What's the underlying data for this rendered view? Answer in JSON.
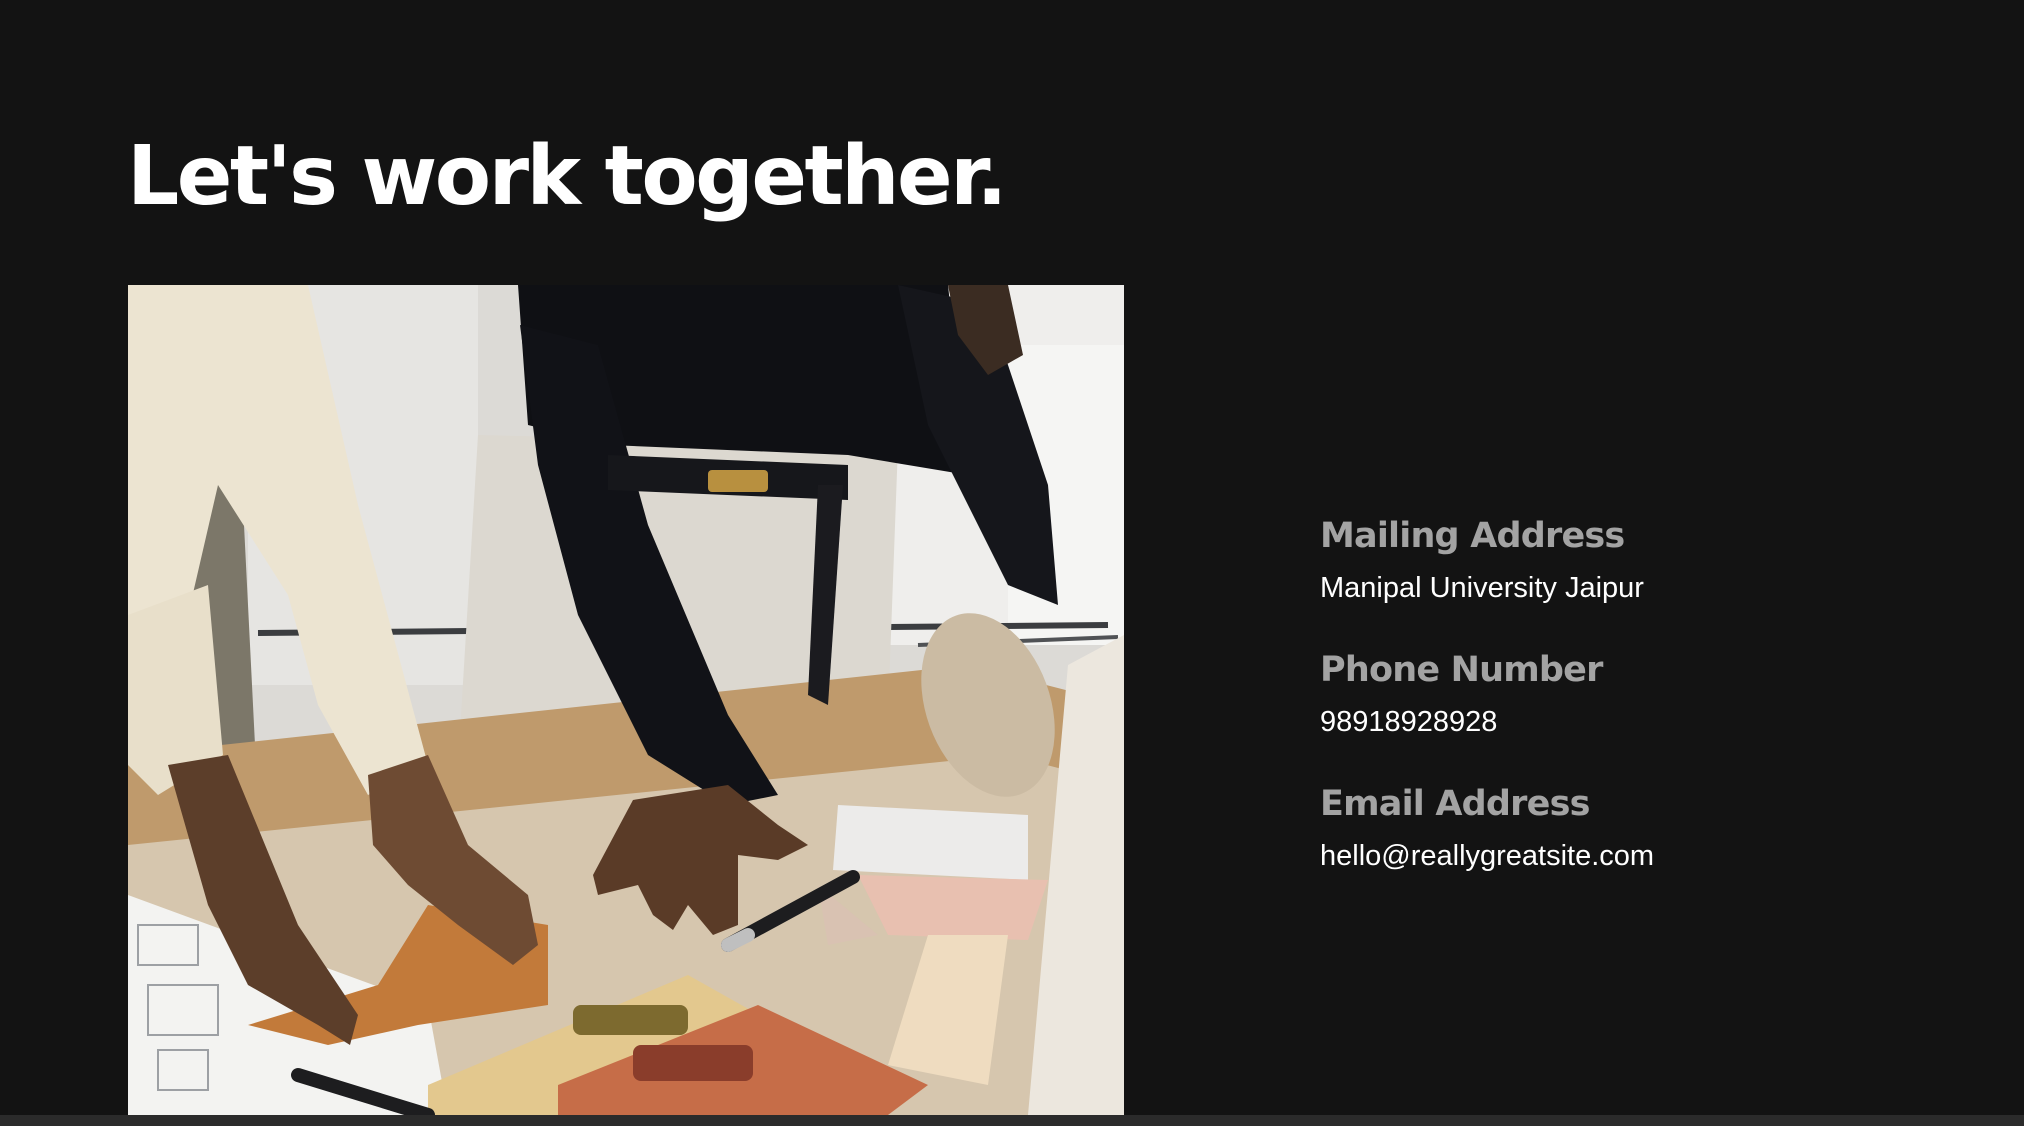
{
  "headline": "Let's work together.",
  "contact": {
    "mailing_label": "Mailing Address",
    "mailing_value": "Manipal University Jaipur",
    "phone_label": "Phone Number",
    "phone_value": "98918928928",
    "email_label": "Email Address",
    "email_value": "hello@reallygreatsite.com"
  },
  "photo": {
    "icon": "photo-people-at-design-table"
  },
  "colors": {
    "background": "#131313",
    "headline": "#ffffff",
    "label": "#a3a3a3",
    "value": "#ffffff",
    "bottom_bar": "#2b2b2b"
  }
}
